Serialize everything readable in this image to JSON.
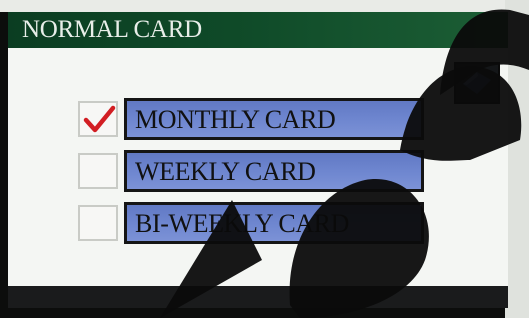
{
  "screen": {
    "title": "NORMAL CARD",
    "back_button": {
      "icon": "back-arrow-icon"
    },
    "options": [
      {
        "label": "MONTHLY CARD",
        "checked": true
      },
      {
        "label": "WEEKLY CARD",
        "checked": false
      },
      {
        "label": "BI-WEEKLY CARD",
        "checked": false
      }
    ]
  },
  "colors": {
    "title_bar": "#0f4a28",
    "option_fill": "#6f87d0",
    "checkmark": "#d21e23"
  }
}
